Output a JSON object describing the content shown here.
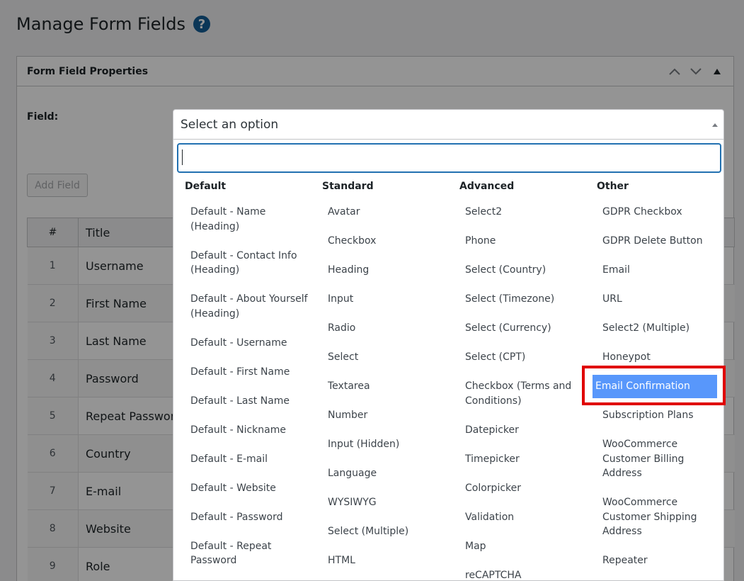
{
  "page": {
    "title": "Manage Form Fields",
    "help_icon": "question-circle-icon"
  },
  "postbox": {
    "title": "Form Field Properties",
    "controls": [
      "chevron-up-icon",
      "chevron-down-icon",
      "triangle-up-icon"
    ]
  },
  "form": {
    "field_label": "Field:",
    "add_button_label": "Add Field"
  },
  "table": {
    "headers": [
      "#",
      "Title"
    ],
    "rows": [
      {
        "num": "1",
        "title": "Username"
      },
      {
        "num": "2",
        "title": "First Name"
      },
      {
        "num": "3",
        "title": "Last Name"
      },
      {
        "num": "4",
        "title": "Password"
      },
      {
        "num": "5",
        "title": "Repeat Password"
      },
      {
        "num": "6",
        "title": "Country"
      },
      {
        "num": "7",
        "title": "E-mail"
      },
      {
        "num": "8",
        "title": "Website"
      },
      {
        "num": "9",
        "title": "Role"
      }
    ]
  },
  "select": {
    "placeholder": "Select an option",
    "search_value": "",
    "groups": [
      {
        "label": "Default",
        "options": [
          "Default - Name (Heading)",
          "Default - Contact Info (Heading)",
          "Default - About Yourself (Heading)",
          "Default - Username",
          "Default - First Name",
          "Default - Last Name",
          "Default - Nickname",
          "Default - E-mail",
          "Default - Website",
          "Default - Password",
          "Default - Repeat Password"
        ]
      },
      {
        "label": "Standard",
        "options": [
          "Avatar",
          "Checkbox",
          "Heading",
          "Input",
          "Radio",
          "Select",
          "Textarea",
          "Number",
          "Input (Hidden)",
          "Language",
          "WYSIWYG",
          "Select (Multiple)",
          "HTML"
        ]
      },
      {
        "label": "Advanced",
        "options": [
          "Select2",
          "Phone",
          "Select (Country)",
          "Select (Timezone)",
          "Select (Currency)",
          "Select (CPT)",
          "Checkbox (Terms and Conditions)",
          "Datepicker",
          "Timepicker",
          "Colorpicker",
          "Validation",
          "Map",
          "reCAPTCHA"
        ]
      },
      {
        "label": "Other",
        "options": [
          "GDPR Checkbox",
          "GDPR Delete Button",
          "Email",
          "URL",
          "Select2 (Multiple)",
          "Honeypot",
          "Email Confirmation",
          "Subscription Plans",
          "WooCommerce Customer Billing Address",
          "WooCommerce Customer Shipping Address",
          "Repeater"
        ]
      }
    ],
    "highlighted_option": "Email Confirmation"
  },
  "colors": {
    "accent": "#2271b1",
    "highlight_bg": "#5897fb",
    "annotation_red": "#e00000"
  }
}
